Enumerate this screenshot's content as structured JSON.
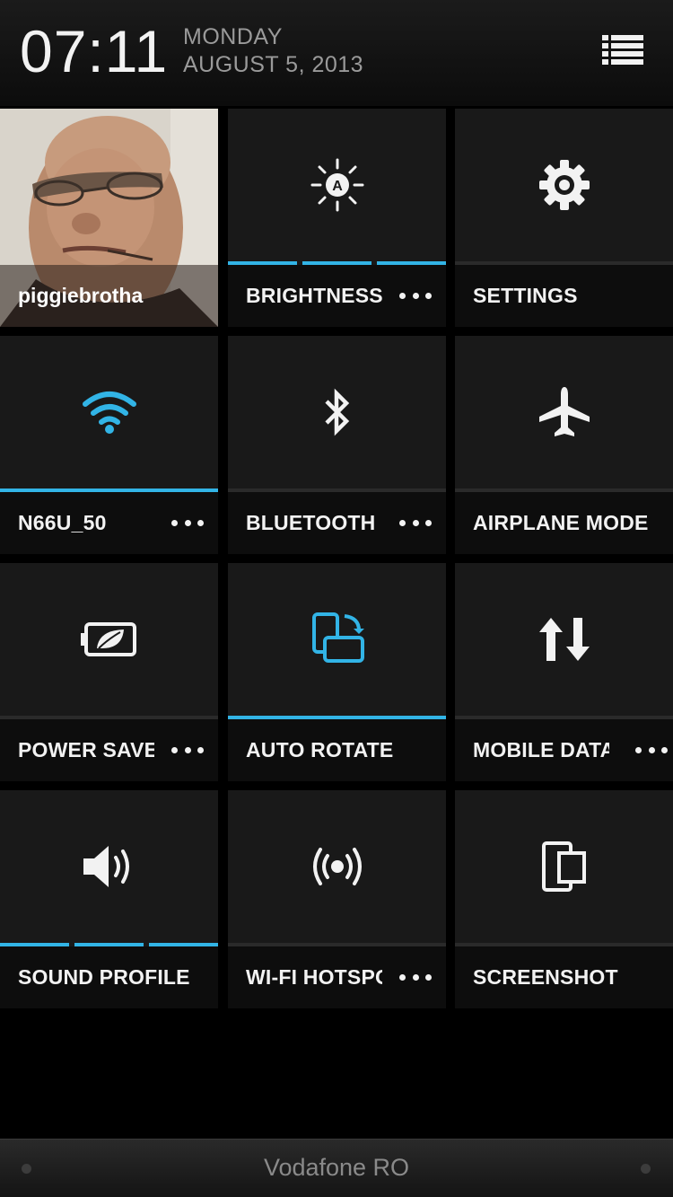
{
  "header": {
    "time": "07:11",
    "day": "MONDAY",
    "date": "AUGUST 5, 2013",
    "menu_icon": "list-icon"
  },
  "profile": {
    "name": "piggiebrotha"
  },
  "tiles": [
    {
      "label": "BRIGHTNESS",
      "icon": "brightness-auto-icon",
      "state": "three-segments-lit",
      "has_more": true
    },
    {
      "label": "SETTINGS",
      "icon": "gear-icon",
      "state": "off",
      "has_more": false
    },
    {
      "label": "N66U_50",
      "icon": "wifi-icon",
      "state": "on",
      "has_more": true
    },
    {
      "label": "BLUETOOTH",
      "icon": "bluetooth-icon",
      "state": "off",
      "has_more": true
    },
    {
      "label": "AIRPLANE MODE",
      "icon": "airplane-icon",
      "state": "off",
      "has_more": false
    },
    {
      "label": "POWER SAVER",
      "icon": "battery-leaf-icon",
      "state": "off",
      "has_more": true
    },
    {
      "label": "AUTO ROTATE",
      "icon": "rotate-screen-icon",
      "state": "on",
      "has_more": false
    },
    {
      "label": "MOBILE DATA",
      "icon": "up-down-arrows-icon",
      "state": "off",
      "has_more": true
    },
    {
      "label": "SOUND PROFILE",
      "icon": "speaker-icon",
      "state": "three-segments-lit",
      "has_more": false
    },
    {
      "label": "WI-FI HOTSPOT",
      "icon": "hotspot-icon",
      "state": "off",
      "has_more": true
    },
    {
      "label": "SCREENSHOT",
      "icon": "screenshot-icon",
      "state": "off",
      "has_more": false
    }
  ],
  "colors": {
    "accent": "#32b4e6",
    "tile_bg": "#191919",
    "label_bg": "#0d0d0d"
  },
  "footer": {
    "carrier": "Vodafone RO"
  }
}
